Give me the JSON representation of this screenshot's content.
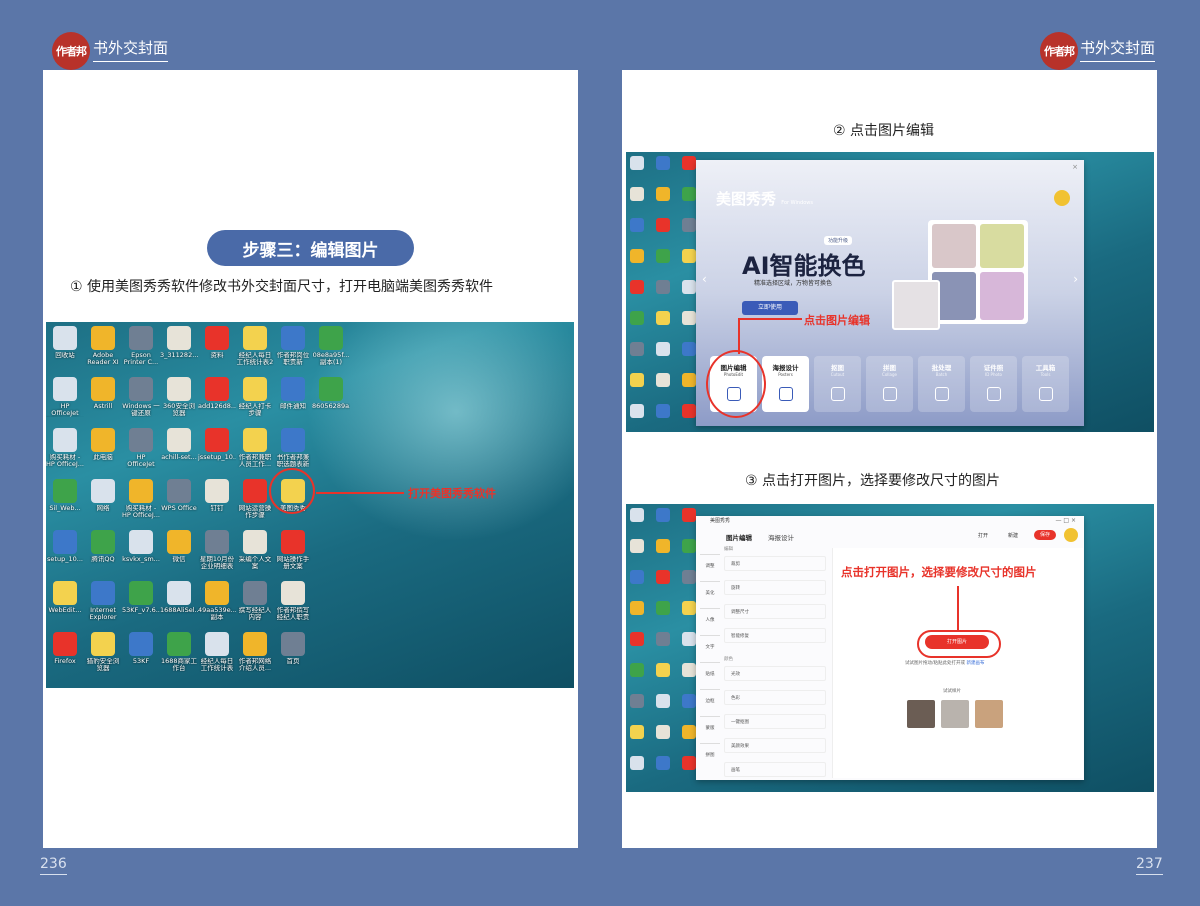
{
  "header": {
    "logo_text": "作者邦",
    "brand_left": "书外交封面",
    "brand_right": "书外交封面"
  },
  "left_page": {
    "step_title": "步骤三：编辑图片",
    "instruction": "① 使用美图秀秀软件修改书外交封面尺寸，打开电脑端美图秀秀软件",
    "callout": "打开美图秀秀软件",
    "page_number": "236",
    "desktop_icons": [
      "回收站",
      "Adobe Reader XI",
      "Epson Printer C...",
      "3_311282...",
      "资料",
      "经纪人每日工作统计表2",
      "作者邦岗位职责新",
      "08e8a95f...副本(1)",
      "HP OfficeJet 5610 series",
      "Astrill",
      "Windows 一键还原",
      "360安全浏览器",
      "add126d8...",
      "经纪人打卡步骤",
      "邮件通知",
      "86056289a...",
      "购买耗材 - HP OfficeJ...",
      "此电脑",
      "HP OfficeJet Pro 6970",
      "achill-set...",
      "jssetup_10...",
      "作者邦兼职人员工作...",
      "书作者邦兼职选题表新",
      "Sil_Web...",
      "网络",
      "购买耗材 - HP OfficeJ...",
      "WPS Office",
      "钉钉",
      "网站运营操作步骤",
      "美图秀秀",
      "setup_10...",
      "腾讯QQ",
      "ksvkx_sm...",
      "微信",
      "星期10月份企业明细表",
      "采编个人文案",
      "网站操作手册文案",
      "WebEdit...",
      "Internet Explorer",
      "53KF_v7.6...",
      "1688AliSel...",
      "49aa539e...副本",
      "撰写经纪人内容",
      "作者邦撰写经纪人职责",
      "Firefox",
      "猎豹安全浏览器",
      "53KF",
      "1688商家工作台",
      "经纪人每日工作统计表",
      "作者邦网络介绍人员...",
      "首页"
    ]
  },
  "right_page": {
    "step2_caption": "② 点击图片编辑",
    "step3_caption": "③ 点击打开图片，选择要修改尺寸的图片",
    "page_number": "237",
    "app1": {
      "app_name": "美图秀秀",
      "edition": "For Windows",
      "banner_tag": "功能升级",
      "banner_title": "AI智能换色",
      "banner_sub": "精准选择区域，万物皆可换色",
      "banner_button": "立即使用",
      "callout": "点击图片编辑",
      "tiles": [
        {
          "label": "图片编辑",
          "sub": "PhotoEdit"
        },
        {
          "label": "海报设计",
          "sub": "Posters"
        },
        {
          "label": "抠图",
          "sub": "Cutout"
        },
        {
          "label": "拼图",
          "sub": "Collage"
        },
        {
          "label": "批处理",
          "sub": "Batch"
        },
        {
          "label": "证件照",
          "sub": "ID Photo"
        },
        {
          "label": "工具箱",
          "sub": "Tools"
        }
      ]
    },
    "app2": {
      "app_name": "美图秀秀",
      "tab_edit": "图片编辑",
      "tab_poster": "海报设计",
      "btn_open": "打开",
      "btn_new": "新建",
      "btn_save": "保存",
      "callout": "点击打开图片，选择要修改尺寸的图片",
      "open_button": "打开图片",
      "hint": "试试图片拖动/粘贴此处打开或",
      "hint_link": "新建画布",
      "sample_label": "试试样片",
      "sidebar_items": [
        "调整",
        "美化",
        "人像",
        "文字",
        "贴纸",
        "边框",
        "蒙版",
        "拼图"
      ],
      "panel_rows": [
        "裁剪",
        "旋转",
        "调整尺寸",
        "智能修复",
        "光效",
        "色彩",
        "一键抠图",
        "美颜效果",
        "画笔"
      ],
      "panel_groups": [
        "编辑",
        "颜色"
      ]
    }
  },
  "colors": {
    "background": "#5b76a8",
    "accent_red": "#e8332a",
    "pill_blue": "#4a6aa8",
    "logo_red": "#b8322a"
  }
}
